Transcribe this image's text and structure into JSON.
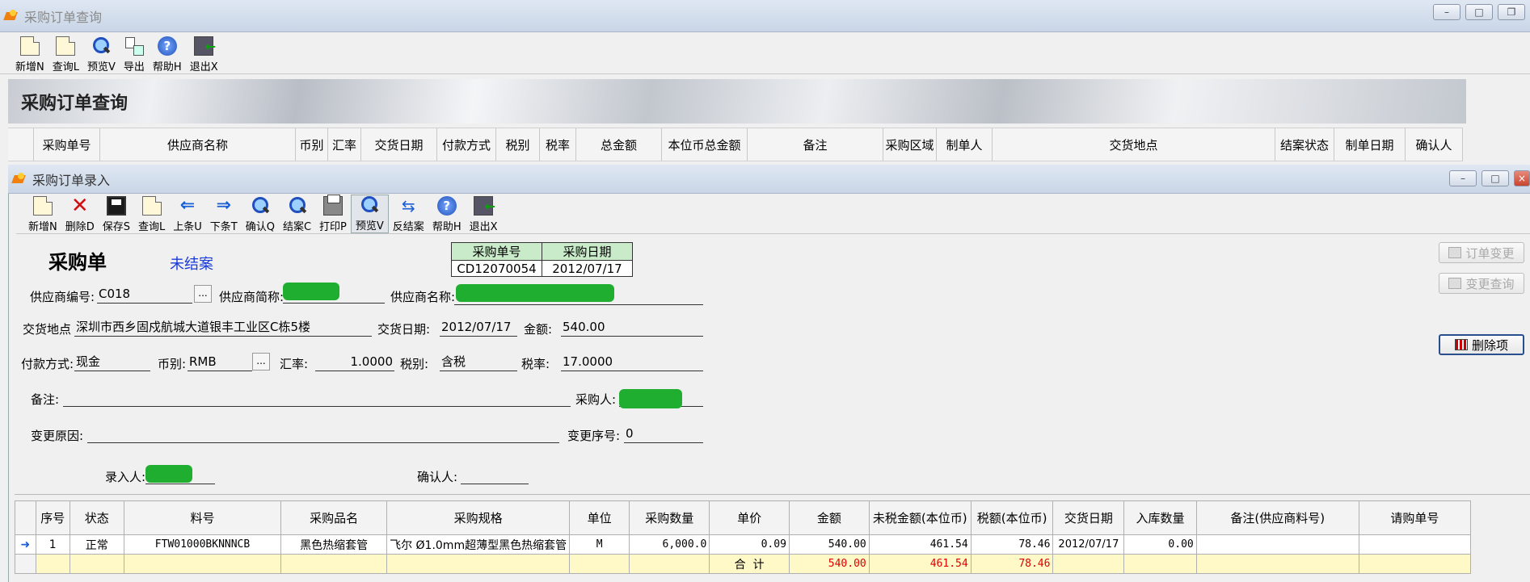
{
  "outer": {
    "title": "采购订单查询",
    "banner": "采购订单查询",
    "toolbar": [
      {
        "label": "新增N",
        "icon": "new-doc-icon"
      },
      {
        "label": "查询L",
        "icon": "query-icon"
      },
      {
        "label": "预览V",
        "icon": "preview-icon"
      },
      {
        "label": "导出",
        "icon": "export-icon"
      },
      {
        "label": "帮助H",
        "icon": "help-icon"
      },
      {
        "label": "退出X",
        "icon": "exit-icon"
      }
    ],
    "columns": [
      "采购单号",
      "供应商名称",
      "币别",
      "汇率",
      "交货日期",
      "付款方式",
      "税别",
      "税率",
      "总金额",
      "本位币总金额",
      "备注",
      "采购区域",
      "制单人",
      "交货地点",
      "结案状态",
      "制单日期",
      "确认人"
    ]
  },
  "inner": {
    "title": "采购订单录入",
    "toolbar": [
      {
        "label": "新增N",
        "icon": "new-doc-icon"
      },
      {
        "label": "删除D",
        "icon": "delete-icon"
      },
      {
        "label": "保存S",
        "icon": "save-icon"
      },
      {
        "label": "查询L",
        "icon": "query-icon"
      },
      {
        "label": "上条U",
        "icon": "arrow-left-icon"
      },
      {
        "label": "下条T",
        "icon": "arrow-right-icon"
      },
      {
        "label": "确认Q",
        "icon": "confirm-icon"
      },
      {
        "label": "结案C",
        "icon": "close-case-icon"
      },
      {
        "label": "打印P",
        "icon": "print-icon"
      },
      {
        "label": "预览V",
        "icon": "preview-icon"
      },
      {
        "label": "反结案",
        "icon": "reverse-icon"
      },
      {
        "label": "帮助H",
        "icon": "help-icon"
      },
      {
        "label": "退出X",
        "icon": "exit-icon"
      }
    ],
    "form_title": "采购单",
    "status": "未结案",
    "order_box": {
      "no_label": "采购单号",
      "date_label": "采购日期",
      "no": "CD12070054",
      "date": "2012/07/17"
    },
    "fields": {
      "supplier_code_label": "供应商编号:",
      "supplier_code": "C018",
      "supplier_short_label": "供应商简称:",
      "supplier_name_label": "供应商名称:",
      "delivery_place_label": "交货地点",
      "delivery_place": "深圳市西乡固戍航城大道银丰工业区C栋5楼",
      "delivery_date_label": "交货日期:",
      "delivery_date": "2012/07/17",
      "amount_label": "金额:",
      "amount": "540.00",
      "payment_label": "付款方式:",
      "payment": "现金",
      "currency_label": "币别:",
      "currency": "RMB",
      "rate_label": "汇率:",
      "rate": "1.0000",
      "tax_type_label": "税别:",
      "tax_type": "含税",
      "tax_rate_label": "税率:",
      "tax_rate": "17.0000",
      "remark_label": "备注:",
      "remark": "",
      "buyer_label": "采购人:",
      "change_reason_label": "变更原因:",
      "change_reason": "",
      "change_seq_label": "变更序号:",
      "change_seq": "0",
      "entry_label": "录入人:",
      "confirmer_label": "确认人:",
      "confirmer": ""
    },
    "side_buttons": {
      "order_change": "订单变更",
      "change_query": "变更查询",
      "delete_item": "删除项"
    },
    "grid": {
      "columns": [
        "序号",
        "状态",
        "料号",
        "采购品名",
        "采购规格",
        "单位",
        "采购数量",
        "单价",
        "金额",
        "未税金额(本位币)",
        "税额(本位币)",
        "交货日期",
        "入库数量",
        "备注(供应商料号)",
        "请购单号"
      ],
      "rows": [
        {
          "seq": "1",
          "status": "正常",
          "part": "FTW01000BKNNNCB",
          "name": "黑色热缩套管",
          "spec": "飞尔 Ø1.0mm超薄型黑色热缩套管",
          "unit": "M",
          "qty": "6,000.0",
          "price": "0.09",
          "amount": "540.00",
          "net": "461.54",
          "tax": "78.46",
          "date": "2012/07/17",
          "received": "0.00",
          "remark": "",
          "req": ""
        }
      ],
      "total": {
        "label": "合  计",
        "amount": "540.00",
        "net": "461.54",
        "tax": "78.46"
      }
    }
  }
}
